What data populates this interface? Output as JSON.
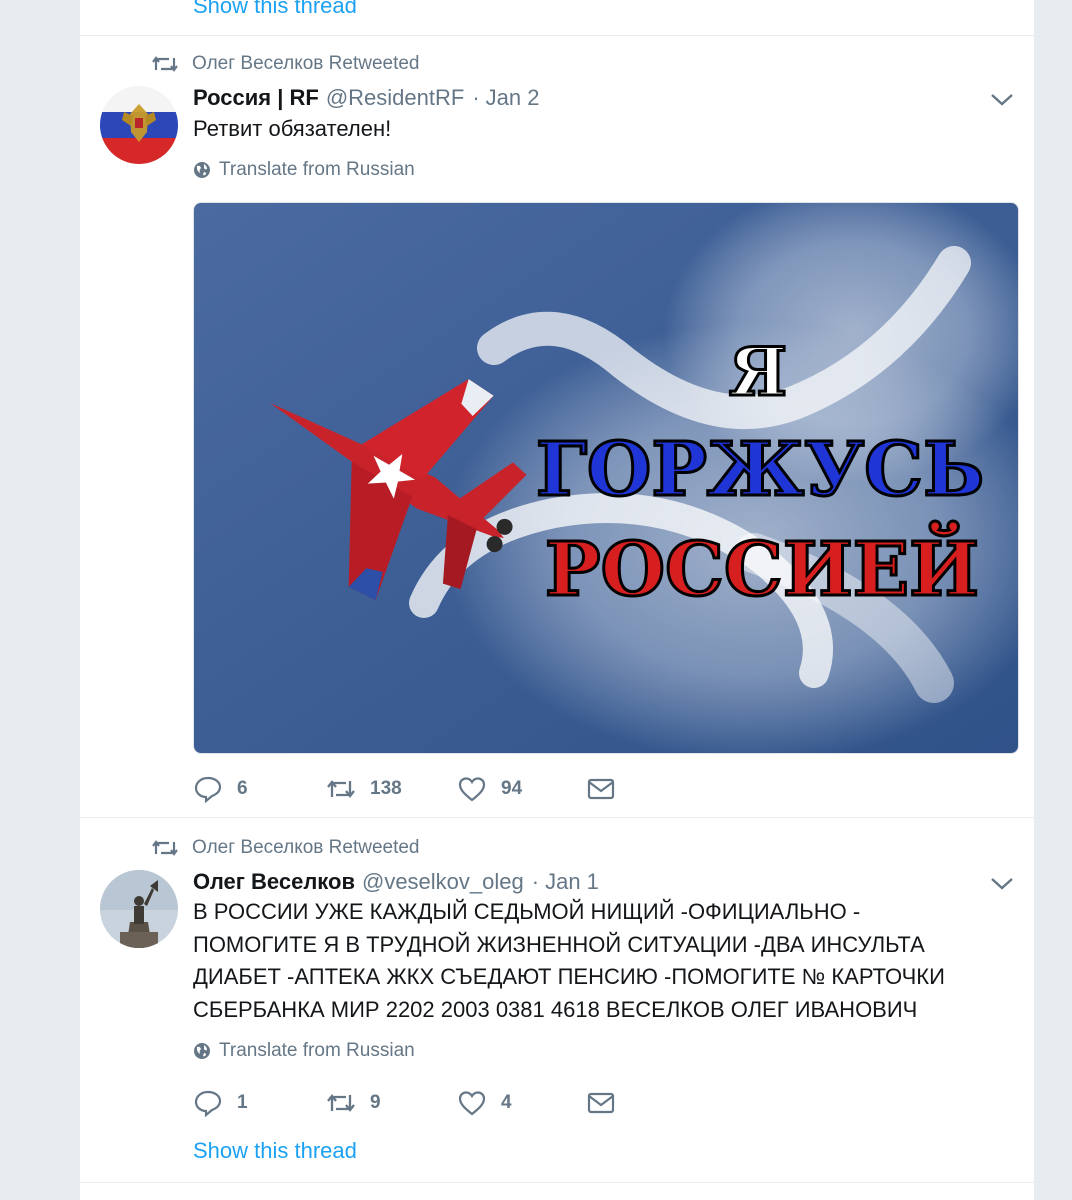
{
  "thread_link": "Show this thread",
  "tweets": [
    {
      "retweeted_by": "Олег Веселков Retweeted",
      "name": "Россия | RF",
      "handle": "@ResidentRF",
      "separator": "·",
      "date": "Jan 2",
      "text": "Ретвит обязателен!",
      "translate": "Translate from Russian",
      "media_text": {
        "line1": "Я",
        "line2": "ГОРЖУСЬ",
        "line3": "РОССИЕЙ"
      },
      "replies": "6",
      "retweets": "138",
      "likes": "94"
    },
    {
      "retweeted_by": "Олег Веселков Retweeted",
      "name": "Олег Веселков",
      "handle": "@veselkov_oleg",
      "separator": "·",
      "date": "Jan 1",
      "text_lines": [
        "В РОССИИ УЖЕ КАЖДЫЙ СЕДЬМОЙ НИЩИЙ -ОФИЦИАЛЬНО -",
        "ПОМОГИТЕ Я В ТРУДНОЙ ЖИЗНЕННОЙ СИТУАЦИИ -ДВА ИНСУЛЬТА",
        "ДИАБЕТ -АПТЕКА ЖКХ СЪЕДАЮТ ПЕНСИЮ -ПОМОГИТЕ № КАРТОЧКИ",
        "СБЕРБАНКА МИР 2202 2003 0381 4618  ВЕСЕЛКОВ ОЛЕГ ИВАНОВИЧ"
      ],
      "translate": "Translate from Russian",
      "replies": "1",
      "retweets": "9",
      "likes": "4"
    }
  ],
  "colors": {
    "link": "#1da1f2",
    "muted": "#657786",
    "text": "#14171a",
    "sky": "#3d5f93",
    "flag_blue": "#1f35d6",
    "flag_red": "#d71f1f"
  },
  "icons": [
    "retweet-icon",
    "caret-down-icon",
    "globe-icon",
    "reply-icon",
    "like-icon",
    "direct-message-icon"
  ]
}
